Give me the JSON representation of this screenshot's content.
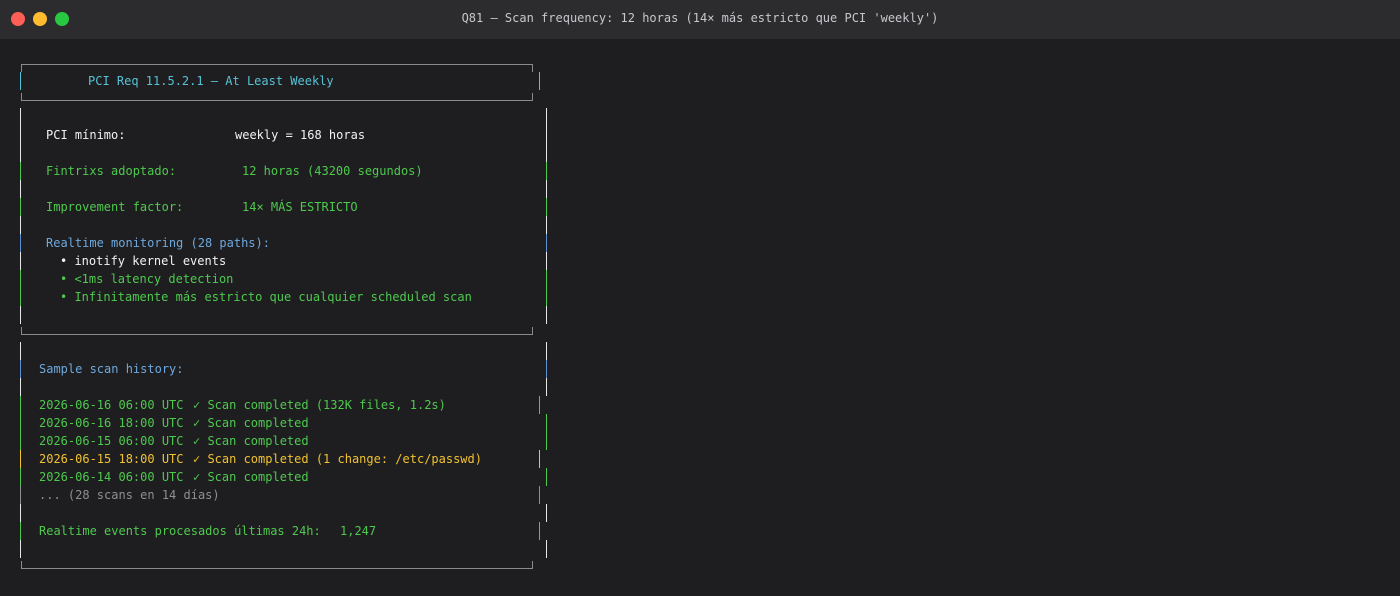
{
  "window": {
    "title": "Q81 — Scan frequency: 12 horas (14× más estricto que PCI 'weekly')"
  },
  "box": {
    "header": "PCI Req 11.5.2.1 — At Least Weekly",
    "pci_min": {
      "label": "PCI mínimo:",
      "value": "weekly = 168 horas"
    },
    "adopted": {
      "label": "Fintrixs adoptado:",
      "value": "12 horas (43200 segundos)"
    },
    "factor": {
      "label": "Improvement factor:",
      "value": "14× MÁS ESTRICTO"
    },
    "realtime": {
      "heading": "Realtime monitoring (28 paths):",
      "bullets": [
        "• inotify kernel events",
        "• <1ms latency detection",
        "• Infinitamente más estricto que cualquier scheduled scan"
      ]
    },
    "history": {
      "heading": "Sample scan history:",
      "rows": [
        {
          "time": "2026-06-16 06:00 UTC",
          "status": "✓ Scan completed (132K files, 1.2s)"
        },
        {
          "time": "2026-06-16 18:00 UTC",
          "status": "✓ Scan completed"
        },
        {
          "time": "2026-06-15 06:00 UTC",
          "status": "✓ Scan completed"
        },
        {
          "time": "2026-06-15 18:00 UTC",
          "status": "✓ Scan completed (1 change: /etc/passwd)"
        },
        {
          "time": "2026-06-14 06:00 UTC",
          "status": "✓ Scan completed"
        }
      ],
      "more": "... (28 scans en 14 días)"
    },
    "events": {
      "label": "Realtime events procesados últimas 24h:",
      "value": "1,247"
    }
  }
}
